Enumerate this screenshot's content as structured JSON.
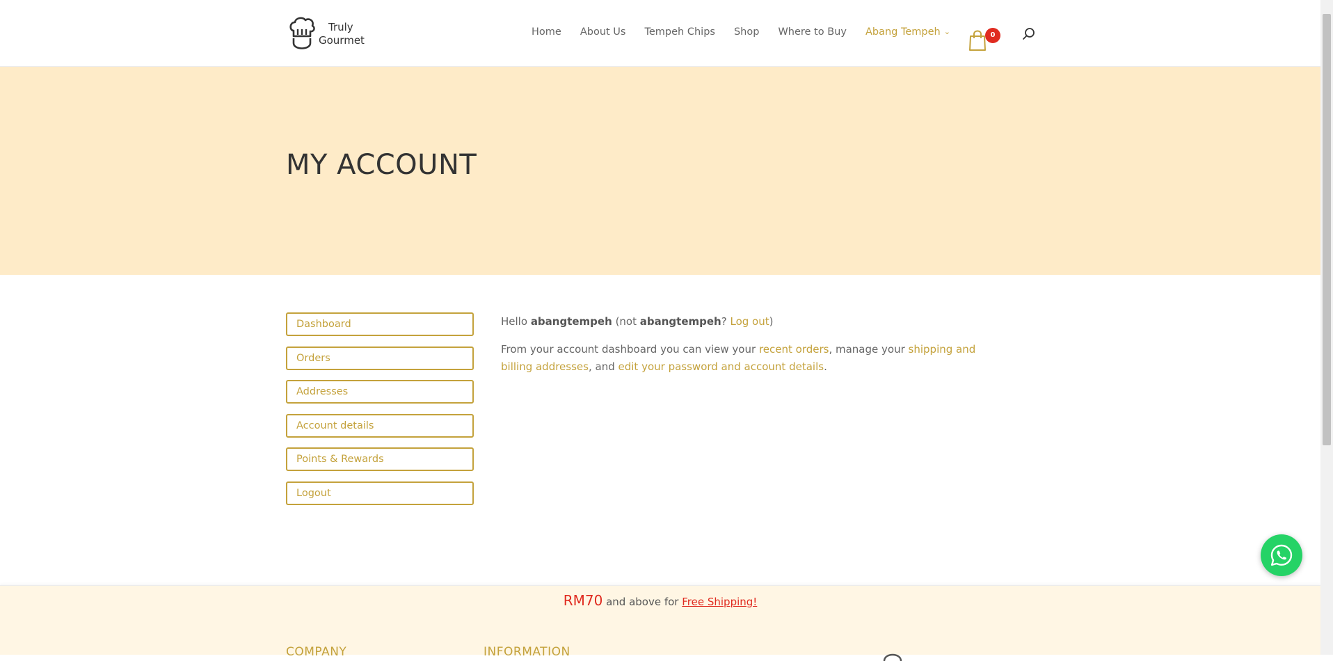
{
  "brand": {
    "logo_line1": "Truly",
    "logo_line2": "Gourmet",
    "accent_color": "#c4a23c",
    "hero_bg": "#feebc8",
    "badge_color": "#e02b20"
  },
  "nav": {
    "items": [
      {
        "label": "Home"
      },
      {
        "label": "About Us"
      },
      {
        "label": "Tempeh Chips"
      },
      {
        "label": "Shop"
      },
      {
        "label": "Where to Buy"
      },
      {
        "label": "Abang Tempeh",
        "active": true,
        "has_dropdown": true
      }
    ],
    "cart_count": "0",
    "cart_icon": "shopping-bag-icon",
    "search_icon": "search-icon"
  },
  "hero": {
    "title": "MY ACCOUNT"
  },
  "account_nav": {
    "items": [
      {
        "label": "Dashboard"
      },
      {
        "label": "Orders"
      },
      {
        "label": "Addresses"
      },
      {
        "label": "Account details"
      },
      {
        "label": "Points & Rewards"
      },
      {
        "label": "Logout"
      }
    ]
  },
  "content": {
    "greeting_hello": "Hello",
    "username": "abangtempeh",
    "greeting_not": "(not",
    "username_repeat": "abangtempeh",
    "question": "?",
    "logout_link": "Log out",
    "close_paren": ")",
    "desc_start": "From your account dashboard you can view your",
    "recent_orders_link": "recent orders",
    "desc_mid": ", manage your",
    "addresses_link": "shipping and billing addresses",
    "desc_and": ", and",
    "account_link": "edit your password and account details",
    "desc_end": "."
  },
  "footer": {
    "promo_amount": "RM70",
    "promo_text": "and above for",
    "promo_link": "Free Shipping!",
    "heading_company": "COMPANY",
    "heading_information": "INFORMATION"
  },
  "floating": {
    "whatsapp_icon": "whatsapp-icon"
  }
}
